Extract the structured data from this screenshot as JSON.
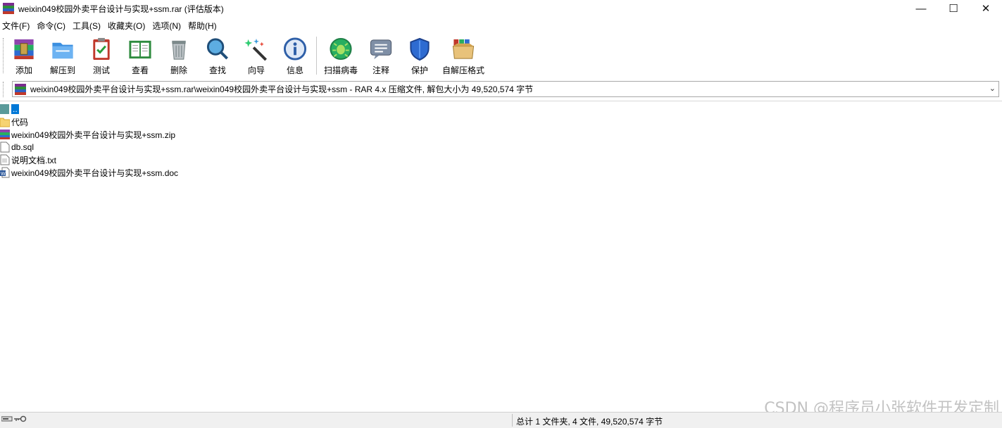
{
  "window": {
    "title": "weixin049校园外卖平台设计与实现+ssm.rar (评估版本)",
    "controls": {
      "minimize": "—",
      "maximize": "☐",
      "close": "✕"
    }
  },
  "menu": [
    "文件(F)",
    "命令(C)",
    "工具(S)",
    "收藏夹(O)",
    "选项(N)",
    "帮助(H)"
  ],
  "toolbar": {
    "add": "添加",
    "extract_to": "解压到",
    "test": "测试",
    "view": "查看",
    "delete": "删除",
    "find": "查找",
    "wizard": "向导",
    "info": "信息",
    "scan_virus": "扫描病毒",
    "comment": "注释",
    "protect": "保护",
    "sfx": "自解压格式"
  },
  "address": {
    "path": "weixin049校园外卖平台设计与实现+ssm.rar\\weixin049校园外卖平台设计与实现+ssm - RAR 4.x 压缩文件, 解包大小为 49,520,574 字节",
    "dropdown_icon": "chevron-down-icon"
  },
  "files": [
    {
      "name": "..",
      "type": "parent",
      "selected": true
    },
    {
      "name": "代码",
      "type": "folder"
    },
    {
      "name": "weixin049校园外卖平台设计与实现+ssm.zip",
      "type": "archive"
    },
    {
      "name": "db.sql",
      "type": "file"
    },
    {
      "name": "说明文档.txt",
      "type": "text"
    },
    {
      "name": "weixin049校园外卖平台设计与实现+ssm.doc",
      "type": "word"
    }
  ],
  "status": {
    "summary": "总计 1 文件夹, 4 文件, 49,520,574 字节"
  },
  "watermark": "CSDN @程序员小张软件开发定制",
  "colors": {
    "selection": "#0078d7",
    "statusbar": "#f0f0f0"
  }
}
